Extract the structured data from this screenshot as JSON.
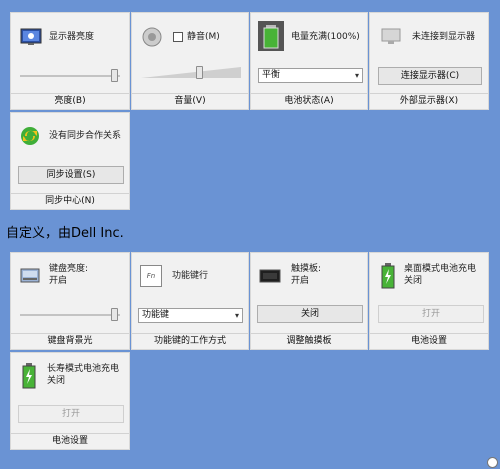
{
  "tiles_row1": {
    "brightness": {
      "title": "显示器亮度",
      "footer": "亮度(B)",
      "slider_value": 0.98
    },
    "volume": {
      "mute_label": "静音(M)",
      "footer": "音量(V)",
      "slider_value": 0.6
    },
    "battery": {
      "title": "电量充满(100%)",
      "plan_value": "平衡",
      "footer": "电池状态(A)"
    },
    "external_display": {
      "title": "未连接到显示器",
      "button": "连接显示器(C)",
      "footer": "外部显示器(X)"
    }
  },
  "tiles_row2": {
    "sync": {
      "title": "没有同步合作关系",
      "button": "同步设置(S)",
      "footer": "同步中心(N)"
    }
  },
  "section_heading": "自定义，由Dell Inc.",
  "tiles_row3": {
    "keyboard_backlight": {
      "title": "键盘亮度:\n开启",
      "footer": "键盘背景光",
      "slider_value": 0.98
    },
    "fn_keys": {
      "title": "功能键行",
      "select_value": "功能键",
      "footer": "功能键的工作方式",
      "icon_text": "Fn"
    },
    "touchpad": {
      "title": "触摸板:\n开启",
      "button": "关闭",
      "footer": "调整触摸板"
    },
    "desktop_battery": {
      "title": "桌面模式电池充电\n关闭",
      "button": "打开",
      "footer": "电池设置"
    }
  },
  "tiles_row4": {
    "longevity_battery": {
      "title": "长寿模式电池充电\n关闭",
      "button": "打开",
      "footer": "电池设置"
    }
  },
  "colors": {
    "background": "#6a93d4",
    "tile": "#f1f1f1"
  }
}
